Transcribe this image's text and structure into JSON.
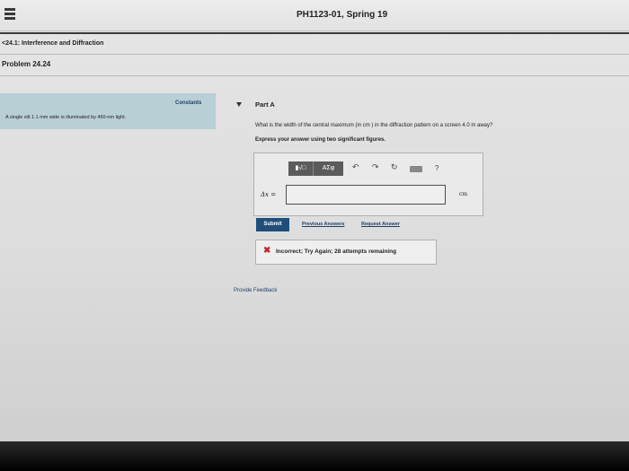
{
  "header": {
    "course_title": "PH1123-01, Spring 19"
  },
  "breadcrumb": "<24.1: Interference and Diffraction",
  "problem": {
    "title": "Problem 24.24",
    "constants_label": "Constants",
    "intro": "A single slit 1.1  mm  wide is illuminated by 460-nm light."
  },
  "part": {
    "title": "Part A",
    "question": "What is the width of the central maximum (in cm ) in the diffraction pattern on a screen 4.0  m away?",
    "instruction": "Express your answer using two significant figures."
  },
  "toolbar": {
    "sqrt_label": "▮√□",
    "greek_label": "AΣφ",
    "undo_icon": "↶",
    "redo_icon": "↷",
    "reset_icon": "↻",
    "help_label": "?"
  },
  "answer": {
    "variable_label": "Δx =",
    "value": "",
    "units": "cm"
  },
  "actions": {
    "submit_label": "Submit",
    "previous_answers_label": "Previous Answers",
    "request_answer_label": "Request Answer"
  },
  "feedback": {
    "icon": "✖",
    "message": "Incorrect; Try Again; 28 attempts remaining"
  },
  "footer": {
    "provide_feedback_label": "Provide Feedback"
  }
}
